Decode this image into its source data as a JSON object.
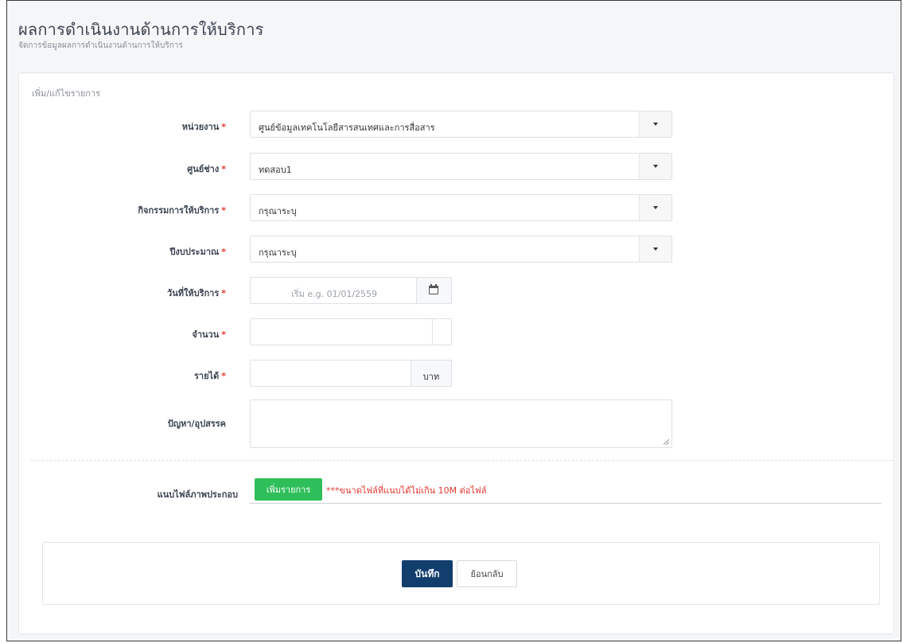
{
  "header": {
    "title": "ผลการดำเนินงานด้านการให้บริการ",
    "subtitle": "จัดการข้อมูลผลการดำเนินงานด้านการให้บริการ"
  },
  "form": {
    "caption": "เพิ่ม/แก้ไขรายการ",
    "required_mark": "*",
    "unit": {
      "label": "หน่วยงาน",
      "value": "ศูนย์ข้อมูลเทคโนโลยีสารสนเทศและการสื่อสาร"
    },
    "center": {
      "label": "ศูนย์ช่าง",
      "value": "ทดสอบ1"
    },
    "activity": {
      "label": "กิจกรรมการให้บริการ",
      "value": "กรุณาระบุ"
    },
    "budget_year": {
      "label": "ปีงบประมาณ",
      "value": "กรุณาระบุ"
    },
    "service_date": {
      "label": "วันที่ให้บริการ",
      "placeholder": "เริ่ม e.g. 01/01/2559",
      "icon": "calendar-icon"
    },
    "quantity": {
      "label": "จำนวน",
      "value": ""
    },
    "income": {
      "label": "รายได้",
      "value": "",
      "suffix": "บาท"
    },
    "problems": {
      "label": "ปัญหา/อุปสรรค",
      "value": ""
    },
    "attachments": {
      "label": "แนบไฟล์ภาพประกอบ",
      "add_button": "เพิ่มรายการ",
      "note": "***ขนาดไฟล์ที่แนบได้ไม่เกิน 10M ต่อไฟล์"
    }
  },
  "actions": {
    "save": "บันทึก",
    "back": "ย้อนกลับ"
  },
  "colors": {
    "primary": "#123e6e",
    "success": "#2fbf5a",
    "danger": "#e0362f"
  }
}
